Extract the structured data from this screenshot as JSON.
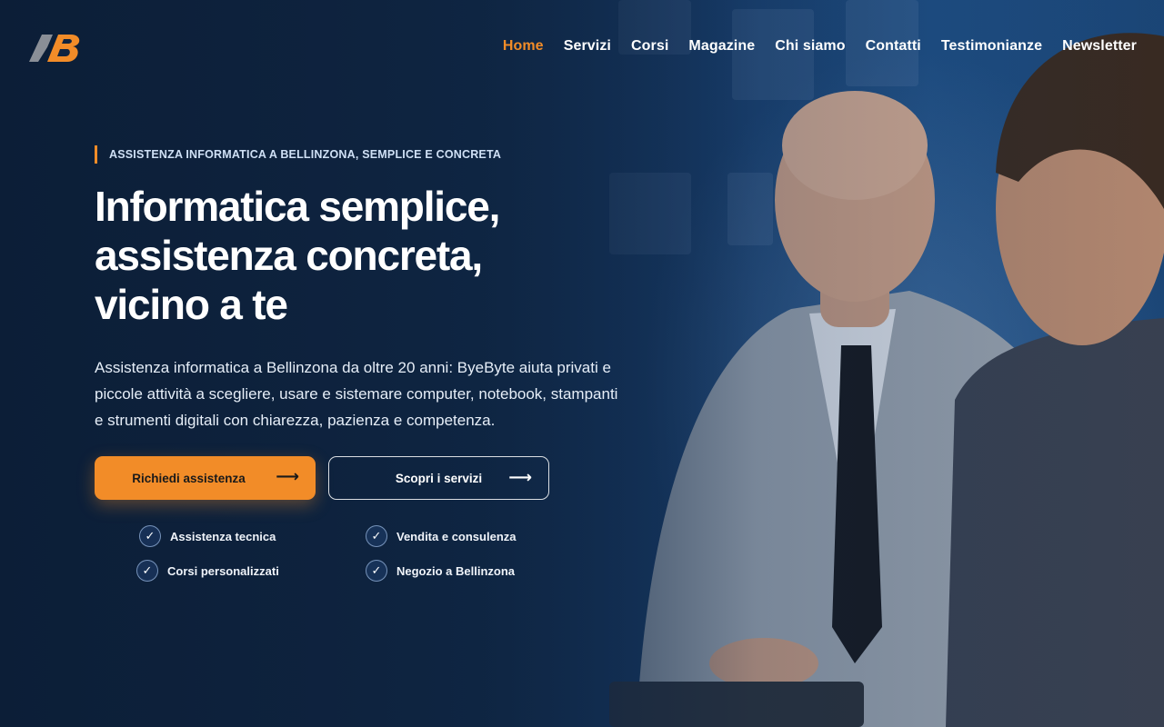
{
  "brand": {
    "logo_icon": "byebyte-logo-icon",
    "accent": "#f28c28",
    "navy": "#0f2440"
  },
  "nav": {
    "items": [
      {
        "label": "Home",
        "active": true
      },
      {
        "label": "Servizi",
        "active": false
      },
      {
        "label": "Corsi",
        "active": false
      },
      {
        "label": "Magazine",
        "active": false
      },
      {
        "label": "Chi siamo",
        "active": false
      },
      {
        "label": "Contatti",
        "active": false
      },
      {
        "label": "Testimonianze",
        "active": false
      },
      {
        "label": "Newsletter",
        "active": false
      }
    ]
  },
  "hero": {
    "eyebrow": "ASSISTENZA INFORMATICA A BELLINZONA, SEMPLICE E CONCRETA",
    "headline": [
      "Informatica semplice,",
      "assistenza concreta,",
      "vicino a te"
    ],
    "lead": "Assistenza informatica a Bellinzona da oltre 20 anni: ByeByte aiuta privati e piccole attività a scegliere, usare e sistemare computer, notebook, stampanti e strumenti digitali con chiarezza, pazienza e competenza.",
    "primary_button": {
      "label": "Richiedi assistenza",
      "icon": "arrow-right-icon"
    },
    "secondary_button": {
      "label": "Scopri i servizi",
      "icon": "arrow-right-icon"
    },
    "features": [
      {
        "label": "Assistenza tecnica",
        "icon": "check-icon"
      },
      {
        "label": "Vendita e consulenza",
        "icon": "check-icon"
      },
      {
        "label": "Corsi personalizzati",
        "icon": "check-icon"
      },
      {
        "label": "Negozio a Bellinzona",
        "icon": "check-icon"
      }
    ]
  }
}
